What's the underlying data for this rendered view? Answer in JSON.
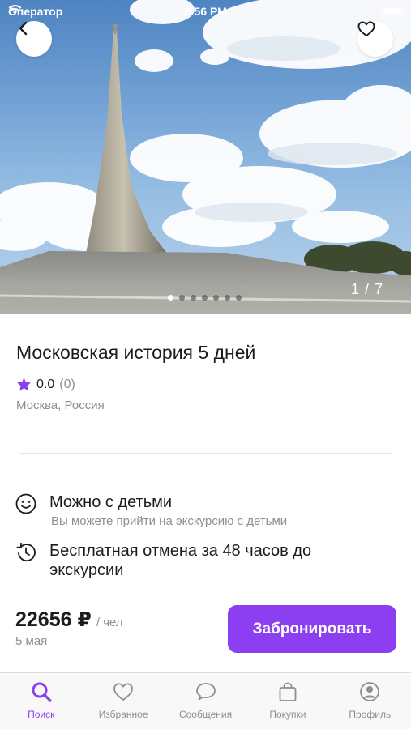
{
  "status_bar": {
    "carrier": "Оператор",
    "time": "8:56 PM"
  },
  "gallery": {
    "counter": "1 / 7",
    "total_dots": 7,
    "active_dot": 0
  },
  "tour": {
    "title": "Московская история 5 дней",
    "rating": "0.0",
    "reviews": "(0)",
    "location": "Москва, Россия"
  },
  "features": [
    {
      "icon": "smile-icon",
      "title": "Можно с детьми",
      "subtitle": "Вы можете прийти на экскурсию с детьми"
    },
    {
      "icon": "history-icon",
      "title": "Бесплатная отмена за 48 часов до экскурсии",
      "subtitle": ""
    }
  ],
  "booking": {
    "price": "22656 ₽",
    "per": "/ чел",
    "date": "5 мая",
    "button": "Забронировать"
  },
  "tabs": [
    {
      "label": "Поиск",
      "icon": "search-icon",
      "active": true
    },
    {
      "label": "Избранное",
      "icon": "heart-icon",
      "active": false
    },
    {
      "label": "Сообщения",
      "icon": "chat-icon",
      "active": false
    },
    {
      "label": "Покупки",
      "icon": "bag-icon",
      "active": false
    },
    {
      "label": "Профиль",
      "icon": "profile-icon",
      "active": false
    }
  ],
  "colors": {
    "accent": "#8b3ff0",
    "star": "#8b3ff0",
    "muted": "#8e8e93"
  }
}
